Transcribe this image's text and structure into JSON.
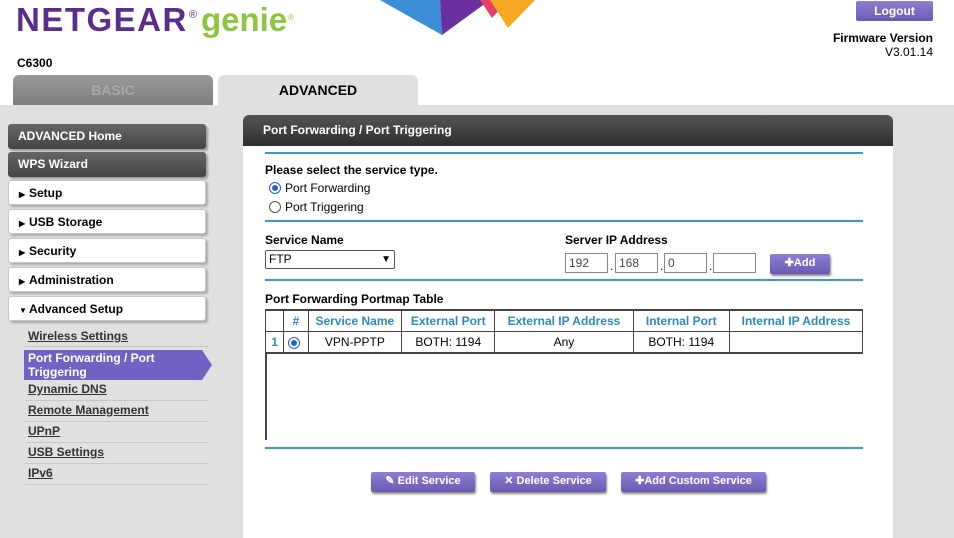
{
  "header": {
    "brand_netgear": "NETGEAR",
    "brand_reg": "®",
    "brand_genie": "genie",
    "brand_tm": "®",
    "model": "C6300",
    "logout_label": "Logout",
    "firmware_label": "Firmware Version",
    "firmware_value": "V3.01.14"
  },
  "tabs": {
    "basic": "BASIC",
    "advanced": "ADVANCED"
  },
  "sidebar": {
    "advanced_home": "ADVANCED Home",
    "wps_wizard": "WPS Wizard",
    "items": [
      "Setup",
      "USB Storage",
      "Security",
      "Administration",
      "Advanced Setup"
    ],
    "sub_items": [
      "Wireless Settings",
      "Port Forwarding / Port Triggering",
      "Dynamic DNS",
      "Remote Management",
      "UPnP",
      "USB Settings",
      "IPv6"
    ]
  },
  "panel": {
    "title": "Port Forwarding / Port Triggering",
    "select_service_type": "Please select the service type.",
    "option_forwarding": "Port Forwarding",
    "option_triggering": "Port Triggering",
    "service_name_label": "Service Name",
    "service_name_value": "FTP",
    "server_ip_label": "Server IP Address",
    "ip": [
      "192",
      "168",
      "0",
      ""
    ],
    "add_label": "Add",
    "table_title": "Port Forwarding Portmap Table",
    "table_headers": [
      "#",
      "Service Name",
      "External Port",
      "External IP Address",
      "Internal Port",
      "Internal IP Address"
    ],
    "table_rows": [
      {
        "index": "1",
        "service": "VPN-PPTP",
        "ext_port": "BOTH: 1194",
        "ext_ip": "Any",
        "int_port": "BOTH: 1194",
        "int_ip": ""
      }
    ],
    "edit_label": "Edit Service",
    "delete_label": "Delete Service",
    "add_custom_label": "Add Custom Service"
  },
  "colors": {
    "brand_purple": "#5b2d8e",
    "brand_green": "#8cc63f",
    "accent_blue": "#3a9ac2",
    "button_purple": "#7a6ac4"
  }
}
